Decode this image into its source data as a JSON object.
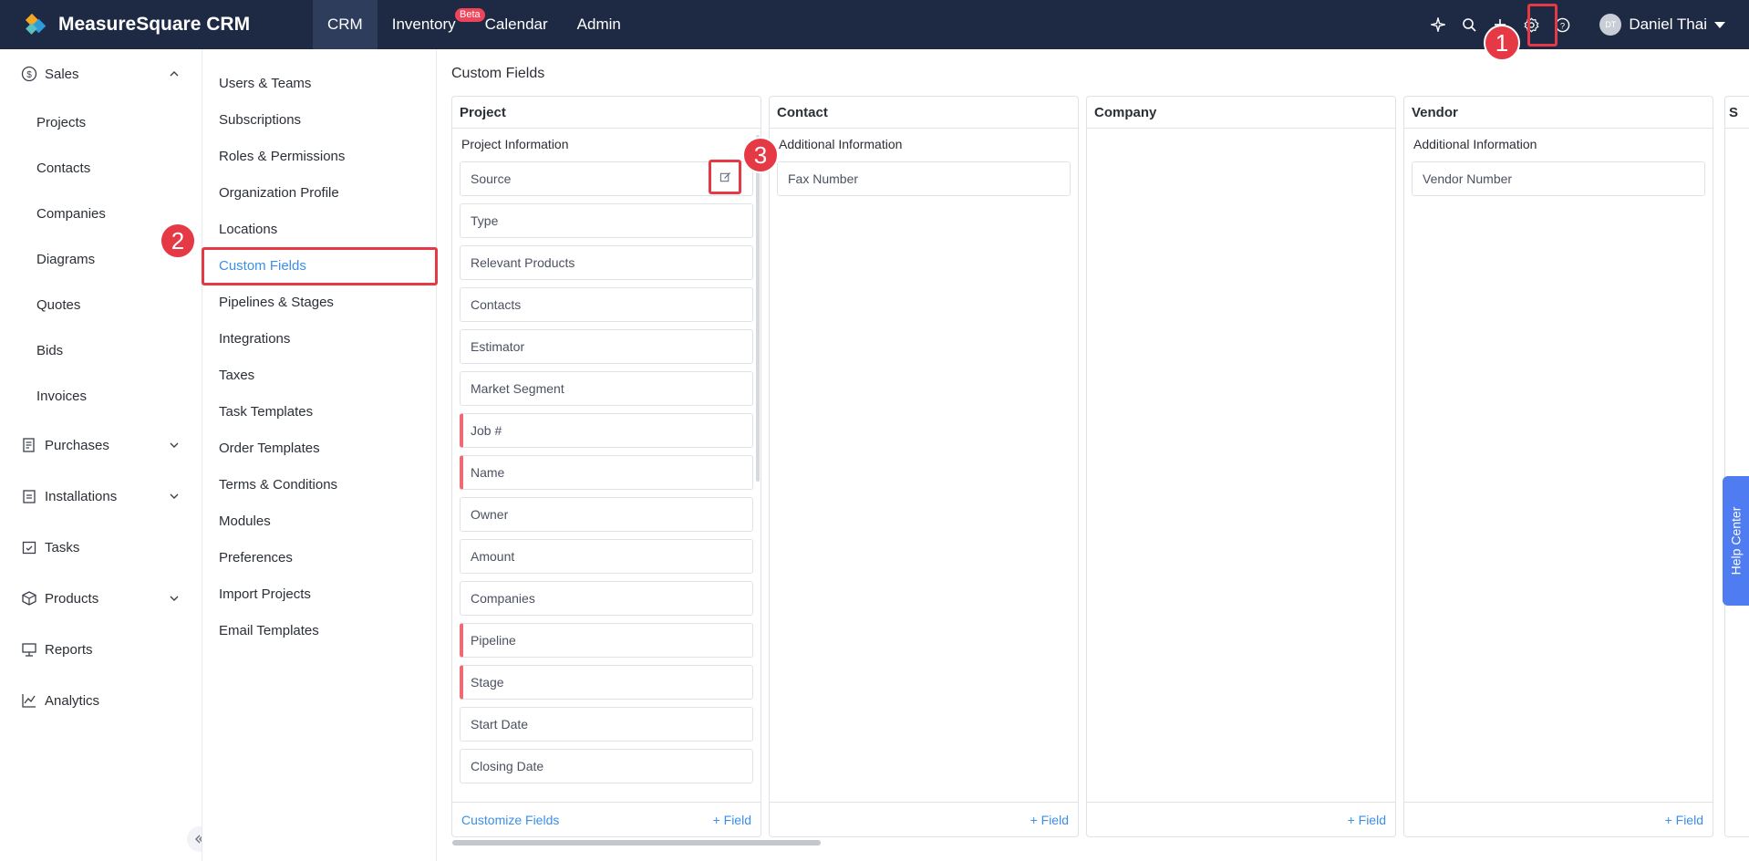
{
  "app": {
    "title": "MeasureSquare CRM"
  },
  "topnav": [
    {
      "label": "CRM"
    },
    {
      "label": "Inventory",
      "badge": "Beta"
    },
    {
      "label": "Calendar"
    },
    {
      "label": "Admin"
    }
  ],
  "user": {
    "initials": "DT",
    "name": "Daniel Thai"
  },
  "sidebar": {
    "sales": "Sales",
    "sales_items": [
      "Projects",
      "Contacts",
      "Companies",
      "Diagrams",
      "Quotes",
      "Bids",
      "Invoices"
    ],
    "purchases": "Purchases",
    "installations": "Installations",
    "tasks": "Tasks",
    "products": "Products",
    "reports": "Reports",
    "analytics": "Analytics"
  },
  "settings_menu": [
    "Users & Teams",
    "Subscriptions",
    "Roles & Permissions",
    "Organization Profile",
    "Locations",
    "Custom Fields",
    "Pipelines & Stages",
    "Integrations",
    "Taxes",
    "Task Templates",
    "Order Templates",
    "Terms & Conditions",
    "Modules",
    "Preferences",
    "Import Projects",
    "Email Templates"
  ],
  "main": {
    "title": "Custom Fields",
    "columns": {
      "project": {
        "header": "Project",
        "group": "Project Information",
        "fields": [
          "Source",
          "Type",
          "Relevant Products",
          "Contacts",
          "Estimator",
          "Market Segment",
          "Job #",
          "Name",
          "Owner",
          "Amount",
          "Companies",
          "Pipeline",
          "Stage",
          "Start Date",
          "Closing Date"
        ],
        "customize": "Customize Fields",
        "add": "+ Field"
      },
      "contact": {
        "header": "Contact",
        "group": "Additional Information",
        "fields": [
          "Fax Number"
        ],
        "add": "+ Field"
      },
      "company": {
        "header": "Company",
        "add": "+ Field"
      },
      "vendor": {
        "header": "Vendor",
        "group": "Additional Information",
        "fields": [
          "Vendor Number"
        ],
        "add": "+ Field"
      },
      "partial": {
        "header": "S"
      }
    }
  },
  "annotations": [
    "1",
    "2",
    "3"
  ],
  "help_center": "Help Center",
  "colors": {
    "topbar": "#1e2a44",
    "accent": "#3b8fe8",
    "highlight": "#e63946",
    "required": "#f06a74",
    "help": "#4f7cf0"
  }
}
